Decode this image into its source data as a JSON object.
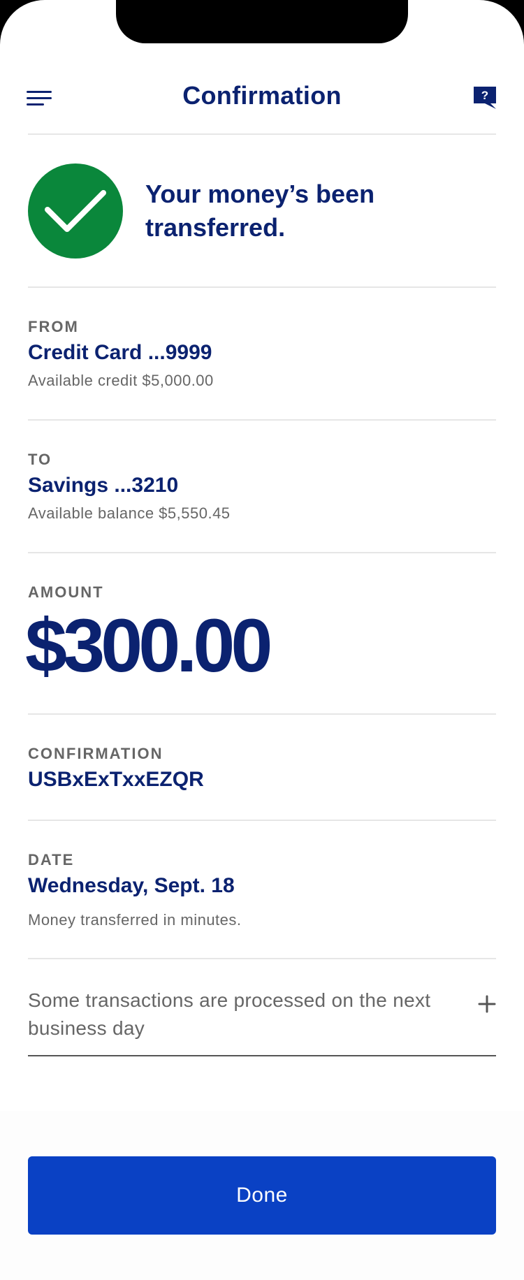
{
  "header": {
    "title": "Confirmation",
    "menu_icon": "hamburger-menu-icon",
    "help_icon": "chat-help-icon",
    "help_glyph": "?"
  },
  "status": {
    "icon": "checkmark-circle-icon",
    "message": "Your money’s been transferred.",
    "color": "#0A873B"
  },
  "from": {
    "label": "FROM",
    "account": "Credit Card ...9999",
    "detail": "Available credit $5,000.00"
  },
  "to": {
    "label": "TO",
    "account": "Savings ...3210",
    "detail": "Available balance $5,550.45"
  },
  "amount": {
    "label": "AMOUNT",
    "value": "$300.00"
  },
  "confirmation": {
    "label": "CONFIRMATION",
    "value": "USBxExTxxEZQR"
  },
  "date": {
    "label": "DATE",
    "value": "Wednesday, Sept. 18",
    "note": "Money transferred in minutes."
  },
  "disclosure": {
    "text": "Some transactions are processed on the next business day",
    "icon": "plus-icon"
  },
  "footer": {
    "done_label": "Done"
  },
  "colors": {
    "brand_navy": "#0B2270",
    "primary_button": "#0A41C4",
    "muted_text": "#666666"
  }
}
